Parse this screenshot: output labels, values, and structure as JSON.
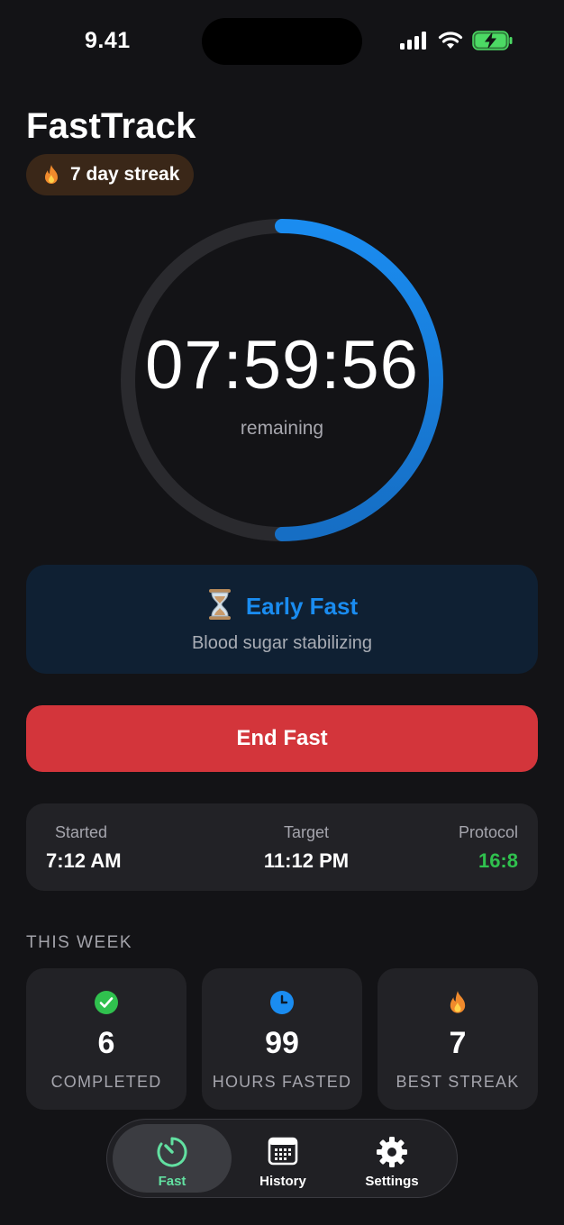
{
  "status_bar": {
    "time": "9.41"
  },
  "app": {
    "title": "FastTrack",
    "streak": "7 day streak"
  },
  "timer": {
    "value": "07:59:56",
    "caption": "remaining",
    "progress": 0.5
  },
  "phase": {
    "emoji": "⏳",
    "name": "Early Fast",
    "description": "Blood sugar stabilizing"
  },
  "actions": {
    "end_label": "End Fast"
  },
  "info": {
    "started_label": "Started",
    "started_value": "7:12 AM",
    "target_label": "Target",
    "target_value": "11:12 PM",
    "protocol_label": "Protocol",
    "protocol_value": "16:8"
  },
  "week": {
    "heading": "THIS WEEK",
    "stats": [
      {
        "icon": "check-circle-icon",
        "value": "6",
        "label": "COMPLETED"
      },
      {
        "icon": "clock-icon",
        "value": "99",
        "label": "HOURS FASTED"
      },
      {
        "icon": "flame-icon",
        "value": "7",
        "label": "BEST STREAK"
      }
    ]
  },
  "tabs": [
    {
      "label": "Fast",
      "icon": "timer-icon",
      "active": true
    },
    {
      "label": "History",
      "icon": "calendar-icon",
      "active": false
    },
    {
      "label": "Settings",
      "icon": "gear-icon",
      "active": false
    }
  ],
  "colors": {
    "accent_blue": "#1a8cf0",
    "end_red": "#d3353b",
    "protocol_green": "#30c14e",
    "active_tab_green": "#62e0a1",
    "flame_orange": "#f08a2c"
  }
}
